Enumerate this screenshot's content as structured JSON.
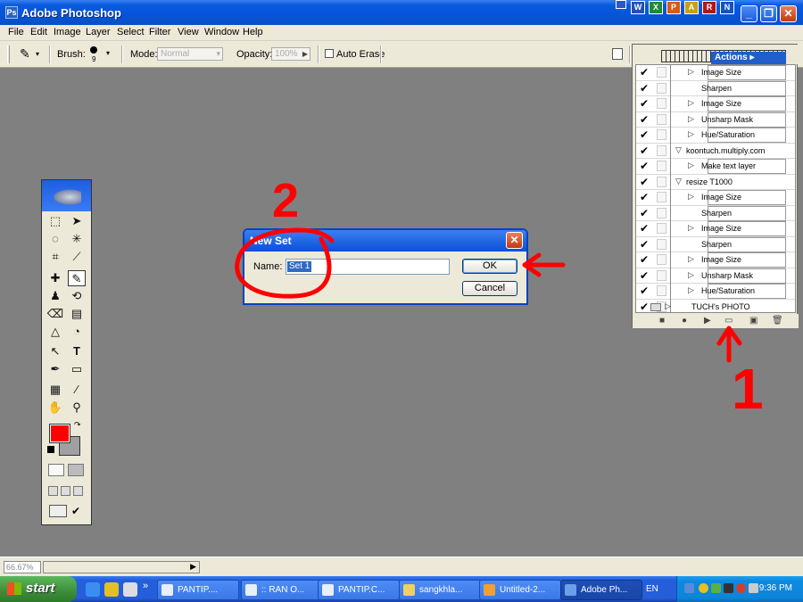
{
  "window": {
    "title": "Adobe Photoshop"
  },
  "menu": [
    "File",
    "Edit",
    "Image",
    "Layer",
    "Select",
    "Filter",
    "View",
    "Window",
    "Help"
  ],
  "options": {
    "brush_label": "Brush:",
    "brush_size": "9",
    "mode_label": "Mode:",
    "mode_value": "Normal",
    "opacity_label": "Opacity:",
    "opacity_value": "100%",
    "auto_erase_label": "Auto Erase"
  },
  "actions_panel": {
    "tab": "Actions",
    "rows": [
      {
        "label": "Image Size",
        "expandable": true
      },
      {
        "label": "Sharpen",
        "expandable": false
      },
      {
        "label": "Image Size",
        "expandable": true
      },
      {
        "label": "Unsharp Mask",
        "expandable": true
      },
      {
        "label": "Hue/Saturation",
        "expandable": true
      },
      {
        "label": "koontuch.multiply.com",
        "kind": "action"
      },
      {
        "label": "Make text layer",
        "expandable": true
      },
      {
        "label": "resize T1000",
        "kind": "action"
      },
      {
        "label": "Image Size",
        "expandable": true
      },
      {
        "label": "Sharpen",
        "expandable": false
      },
      {
        "label": "Image Size",
        "expandable": true
      },
      {
        "label": "Sharpen",
        "expandable": false
      },
      {
        "label": "Image Size",
        "expandable": true
      },
      {
        "label": "Unsharp Mask",
        "expandable": true
      },
      {
        "label": "Hue/Saturation",
        "expandable": true
      },
      {
        "label": "TUCH's PHOTO",
        "kind": "set"
      }
    ]
  },
  "dialog": {
    "title": "New Set",
    "name_label": "Name:",
    "name_value": "Set 1",
    "ok_label": "OK",
    "cancel_label": "Cancel"
  },
  "annotations": {
    "step1": "1",
    "step2": "2",
    "color": "#ff0000"
  },
  "status": {
    "zoom": "66.67%"
  },
  "toolbox": {
    "foreground_color": "#ff0000",
    "background_color": "#a0a0a0"
  },
  "taskbar": {
    "start_label": "start",
    "tasks": [
      "PANTIP....",
      ":: RAN O...",
      "PANTIP.C...",
      "sangkhla...",
      "Untitled-2...",
      "Adobe Ph..."
    ],
    "language": "EN",
    "clock": "9:36 PM"
  }
}
